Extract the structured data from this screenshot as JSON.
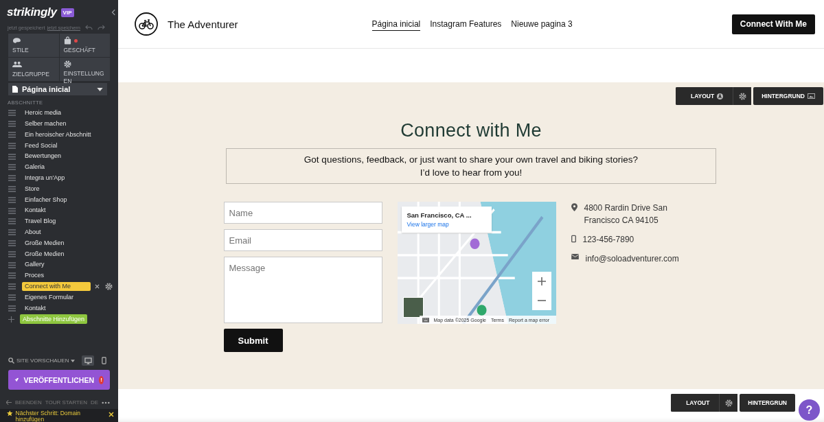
{
  "sidebar": {
    "logo": "strikingly",
    "badge": "VIP",
    "save_status": "jetzt gespeichert",
    "save_link": "jetzt speichern",
    "tiles": [
      {
        "kind": "styles",
        "label": "STILE",
        "alert": false
      },
      {
        "kind": "store",
        "label": "GESCHÄFT",
        "alert": true
      },
      {
        "kind": "audience",
        "label": "ZIELGRUPPE",
        "alert": false
      },
      {
        "kind": "settings",
        "label": "EINSTELLUNGEN",
        "alert": false
      }
    ],
    "page_select": "Página inicial",
    "sections_heading": "ABSCHNITTE",
    "sections": [
      {
        "label": "Heroic media",
        "selected": false
      },
      {
        "label": "Selber machen",
        "selected": false
      },
      {
        "label": "Ein heroischer Abschnitt",
        "selected": false
      },
      {
        "label": "Feed Social",
        "selected": false
      },
      {
        "label": "Bewertungen",
        "selected": false
      },
      {
        "label": "Galeria",
        "selected": false
      },
      {
        "label": "Integra un'App",
        "selected": false
      },
      {
        "label": "Store",
        "selected": false
      },
      {
        "label": "Einfacher Shop",
        "selected": false
      },
      {
        "label": "Kontakt",
        "selected": false
      },
      {
        "label": "Travel Blog",
        "selected": false
      },
      {
        "label": "About",
        "selected": false
      },
      {
        "label": "Große Medien",
        "selected": false
      },
      {
        "label": "Große Medien",
        "selected": false
      },
      {
        "label": "Gallery",
        "selected": false
      },
      {
        "label": "Proces",
        "selected": false
      },
      {
        "label": "Connect with Me",
        "selected": true
      },
      {
        "label": "Eigenes Formular",
        "selected": false
      },
      {
        "label": "Kontakt",
        "selected": false
      }
    ],
    "add_section": "Abschnitte Hinzufügen",
    "preview": "SITE VORSCHAUEN",
    "devices": [
      {
        "kind": "desktop",
        "selected": true
      },
      {
        "kind": "mobile",
        "selected": false
      }
    ],
    "publish": "VERÖFFENTLICHEN",
    "publish_alert": "!",
    "footer_links": [
      "BEENDEN",
      "TOUR STARTEN",
      "DE"
    ],
    "next_step": "Nächster Schritt: Domain hinzufügen"
  },
  "site": {
    "title": "The Adventurer",
    "nav": [
      {
        "label": "Página inicial",
        "selected": true
      },
      {
        "label": "Instagram Features",
        "selected": false
      },
      {
        "label": "Nieuwe pagina 3",
        "selected": false
      }
    ],
    "cta": "Connect With Me"
  },
  "section_tools": {
    "layout": "LAYOUT",
    "background": "HINTERGRUND"
  },
  "contact": {
    "title": "Connect with Me",
    "intro": [
      "Got questions, feedback, or just want to share your own travel and biking stories?",
      "I’d love to hear from you!"
    ],
    "fields": [
      {
        "kind": "line",
        "placeholder": "Name"
      },
      {
        "kind": "line",
        "placeholder": "Email"
      },
      {
        "kind": "area",
        "placeholder": "Message"
      }
    ],
    "submit": "Submit",
    "map": {
      "place": "San Francisco, CA ...",
      "link": "View larger map",
      "attribution": "Map data ©2025 Google",
      "terms": "Terms",
      "report": "Report a map error"
    },
    "info": [
      {
        "kind": "pin",
        "text": "4800 Rardin Drive San Francisco CA 94105"
      },
      {
        "kind": "phone",
        "text": "123-456-7890"
      },
      {
        "kind": "mail",
        "text": "info@soloadventurer.com"
      }
    ]
  },
  "next_section_tools": {
    "layout": "LAYOUT",
    "background": "HINTERGRUN"
  },
  "help": "?"
}
